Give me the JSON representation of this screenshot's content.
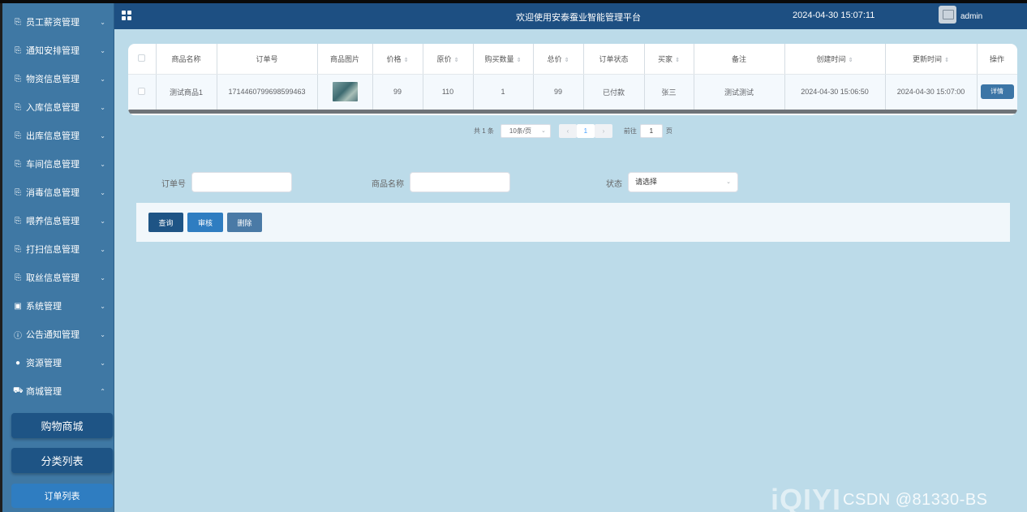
{
  "header": {
    "title": "欢迎使用安泰蚕业智能管理平台",
    "datetime": "2024-04-30 15:07:11",
    "username": "admin"
  },
  "sidebar": {
    "items": [
      {
        "label": "员工薪资管理",
        "icon": "document-icon"
      },
      {
        "label": "通知安排管理",
        "icon": "document-icon"
      },
      {
        "label": "物资信息管理",
        "icon": "document-icon"
      },
      {
        "label": "入库信息管理",
        "icon": "document-icon"
      },
      {
        "label": "出库信息管理",
        "icon": "document-icon"
      },
      {
        "label": "车间信息管理",
        "icon": "document-icon"
      },
      {
        "label": "消毒信息管理",
        "icon": "document-icon"
      },
      {
        "label": "喂养信息管理",
        "icon": "document-icon"
      },
      {
        "label": "打扫信息管理",
        "icon": "document-icon"
      },
      {
        "label": "取丝信息管理",
        "icon": "document-icon"
      },
      {
        "label": "系统管理",
        "icon": "image-icon"
      },
      {
        "label": "公告通知管理",
        "icon": "info-icon"
      },
      {
        "label": "资源管理",
        "icon": "bulb-icon"
      },
      {
        "label": "商城管理",
        "icon": "cart-icon"
      }
    ],
    "submenu": [
      {
        "label": "购物商城"
      },
      {
        "label": "分类列表"
      },
      {
        "label": "订单列表"
      }
    ]
  },
  "table": {
    "columns": [
      "商品名称",
      "订单号",
      "商品图片",
      "价格",
      "原价",
      "购买数量",
      "总价",
      "订单状态",
      "买家",
      "备注",
      "创建时间",
      "更新时间",
      "操作"
    ],
    "rows": [
      {
        "name": "测试商品1",
        "order_no": "1714460799698599463",
        "price": "99",
        "original_price": "110",
        "quantity": "1",
        "total": "99",
        "status": "已付款",
        "buyer": "张三",
        "remark": "测试测试",
        "created": "2024-04-30 15:06:50",
        "updated": "2024-04-30 15:07:00",
        "action": "详情"
      }
    ]
  },
  "pagination": {
    "total": "共 1 条",
    "page_size": "10条/页",
    "current": "1",
    "goto_label": "前往",
    "goto_value": "1",
    "page_unit": "页"
  },
  "search": {
    "order_label": "订单号",
    "order_value": "",
    "name_label": "商品名称",
    "name_value": "",
    "status_label": "状态",
    "status_placeholder": "请选择"
  },
  "actions": {
    "query": "查询",
    "audit": "审核",
    "delete": "删除"
  },
  "watermark": {
    "logo": "iQIYI",
    "text": "CSDN @81330-BS"
  },
  "colors": {
    "sidebar": "#3f78a4",
    "header": "#1d4f82",
    "content_bg": "#bcdbe9",
    "query_btn": "#1e5485",
    "audit_btn": "#2f7dc1",
    "delete_btn": "#4a7aa6"
  }
}
